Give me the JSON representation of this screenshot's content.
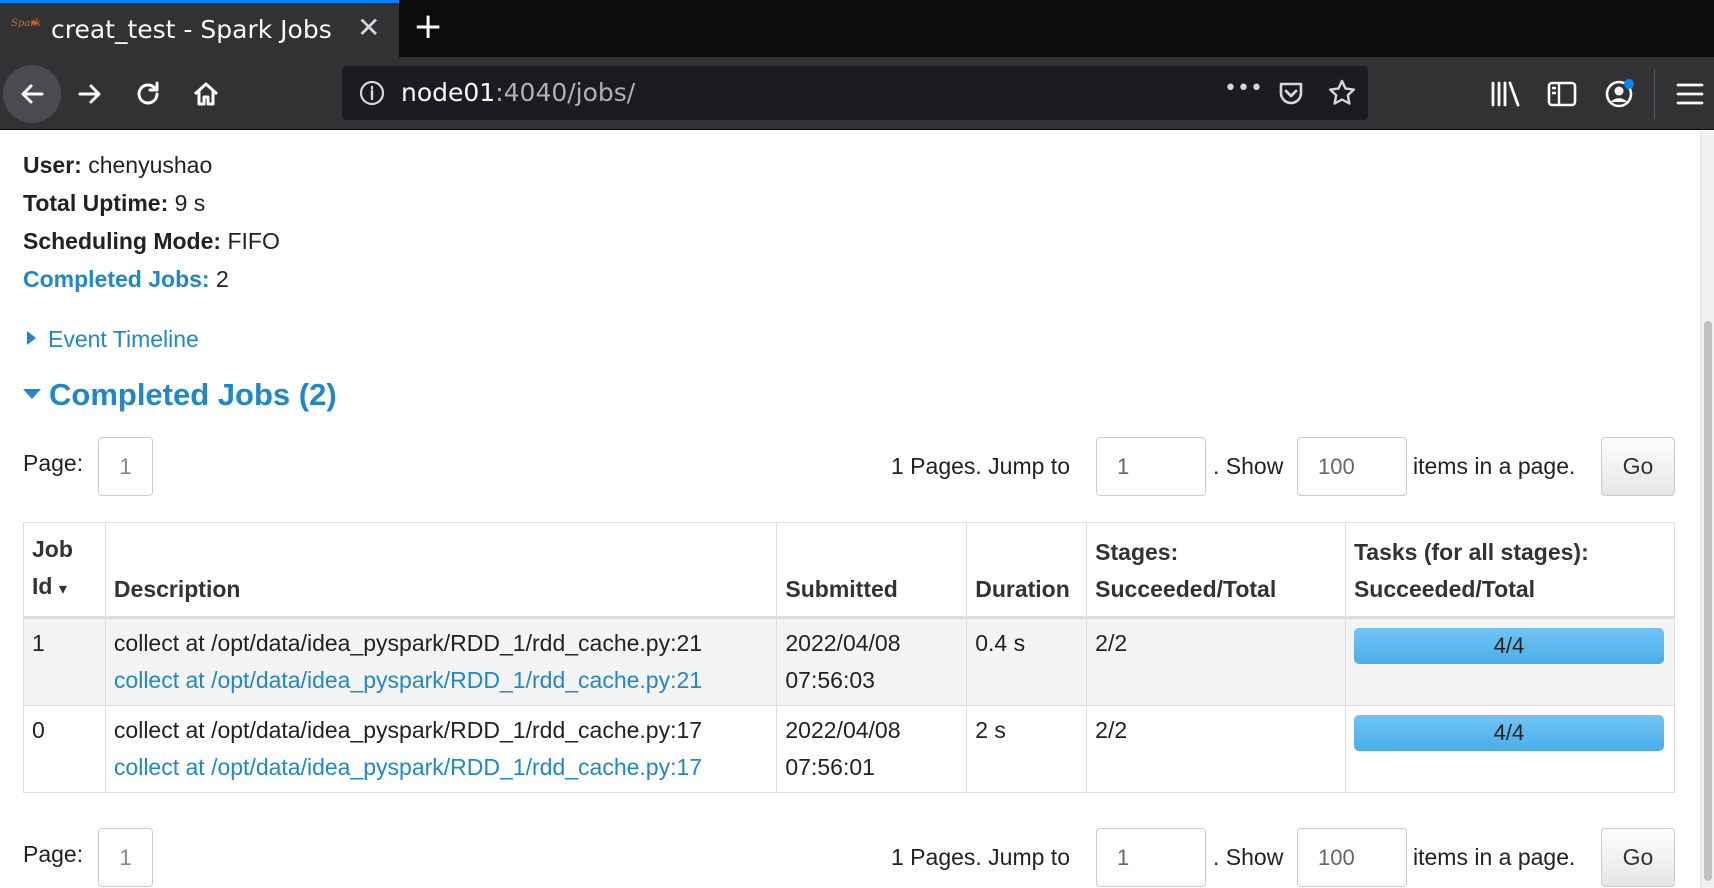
{
  "browser": {
    "tab_title": "creat_test - Spark Jobs",
    "tab_close": "✕",
    "new_tab": "+",
    "favicon_text": "Spark",
    "url_host": "node01",
    "url_path": ":4040/jobs/",
    "url_more": "•••"
  },
  "summary": [
    {
      "label": "User:",
      "value": " chenyushao",
      "is_link": false
    },
    {
      "label": "Total Uptime:",
      "value": " 9 s",
      "is_link": false
    },
    {
      "label": "Scheduling Mode:",
      "value": " FIFO",
      "is_link": false
    },
    {
      "label": "Completed Jobs:",
      "value": " 2",
      "is_link": true
    }
  ],
  "event_timeline": "Event Timeline",
  "section_title": "Completed Jobs (2)",
  "pager": {
    "page_label": "Page:",
    "current_page": "1",
    "pages_text": "1 Pages. Jump to",
    "jump_value": "1",
    "show_text": ". Show",
    "show_value": "100",
    "items_text": "items in a page.",
    "go_label": "Go"
  },
  "table": {
    "headers": {
      "job_id_line1": "Job",
      "job_id_line2": "Id",
      "sort_arrow": "▾",
      "description": "Description",
      "submitted": "Submitted",
      "duration": "Duration",
      "stages_line1": "Stages:",
      "stages_line2": "Succeeded/Total",
      "tasks_line1": "Tasks (for all stages):",
      "tasks_line2": "Succeeded/Total"
    },
    "rows": [
      {
        "job_id": "1",
        "description": "collect at /opt/data/idea_pyspark/RDD_1/rdd_cache.py:21",
        "description_link": "collect at /opt/data/idea_pyspark/RDD_1/rdd_cache.py:21",
        "submitted_date": "2022/04/08",
        "submitted_time": "07:56:03",
        "duration": "0.4 s",
        "stages": "2/2",
        "tasks": "4/4",
        "tasks_progress": 1.0
      },
      {
        "job_id": "0",
        "description": "collect at /opt/data/idea_pyspark/RDD_1/rdd_cache.py:17",
        "description_link": "collect at /opt/data/idea_pyspark/RDD_1/rdd_cache.py:17",
        "submitted_date": "2022/04/08",
        "submitted_time": "07:56:01",
        "duration": "2 s",
        "stages": "2/2",
        "tasks": "4/4",
        "tasks_progress": 1.0
      }
    ]
  },
  "colors": {
    "link": "#1e88c8",
    "progress_bar": "#5bb8ee",
    "chrome_dark": "#0c0c0d",
    "chrome_tab": "#323234"
  },
  "icons": [
    "back-arrow-icon",
    "forward-arrow-icon",
    "reload-icon",
    "home-icon",
    "info-icon",
    "page-actions-icon",
    "pocket-icon",
    "bookmark-star-icon",
    "library-icon",
    "sidebar-icon",
    "account-icon",
    "menu-icon"
  ]
}
